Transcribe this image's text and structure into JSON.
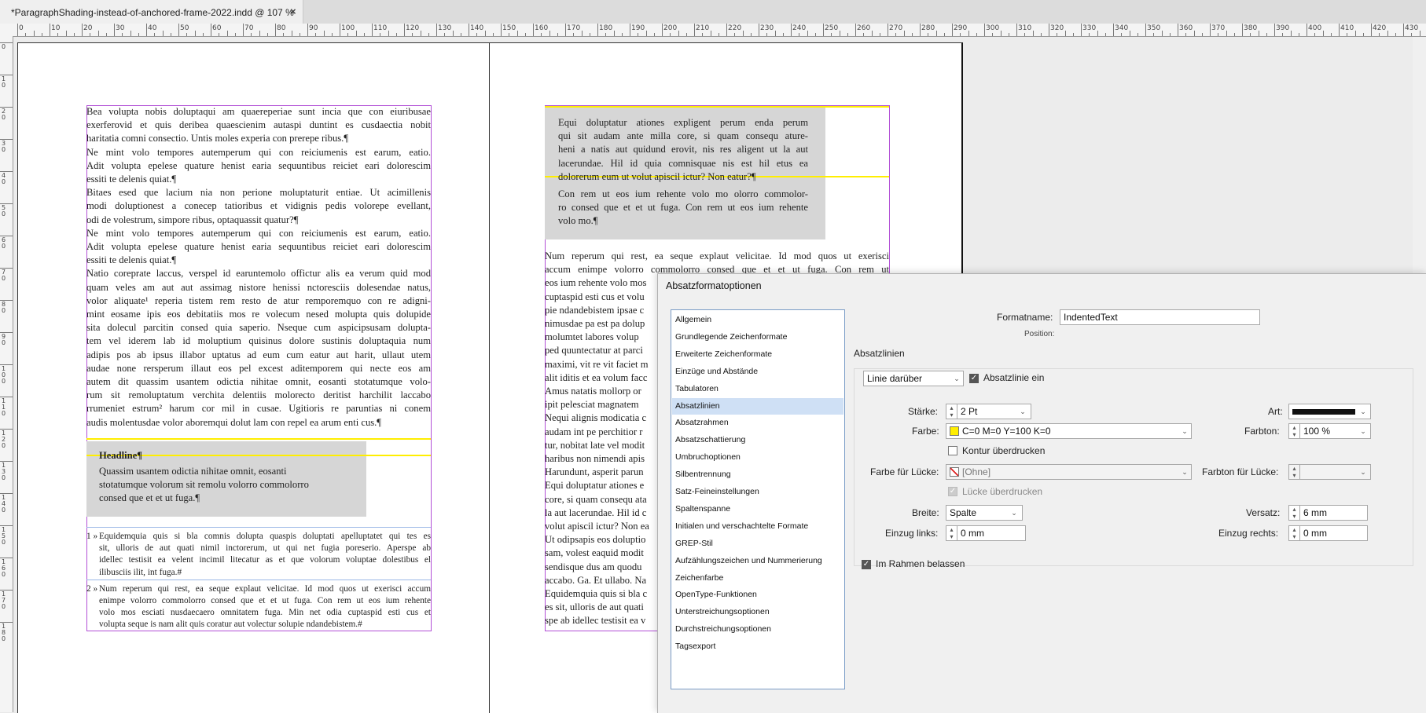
{
  "document_tab": {
    "title": "*ParagraphShading-instead-of-anchored-frame-2022.indd @ 107 %",
    "close": "×"
  },
  "ruler": {
    "h_labels": [
      "0",
      "10",
      "20",
      "30",
      "40",
      "50",
      "60",
      "70",
      "80",
      "90",
      "100",
      "110",
      "120",
      "130",
      "140",
      "150",
      "160",
      "170",
      "180",
      "190",
      "200",
      "210",
      "220",
      "230",
      "240",
      "250",
      "260",
      "270",
      "280",
      "290",
      "300",
      "310",
      "320",
      "330",
      "340",
      "350",
      "360",
      "370",
      "380",
      "390",
      "400",
      "410",
      "420",
      "430"
    ],
    "v_labels": [
      "0",
      "1 0",
      "2 0",
      "3 0",
      "4 0",
      "5 0",
      "6 0",
      "7 0",
      "8 0",
      "9 0",
      "1 0 0",
      "1 1 0",
      "1 2 0",
      "1 3 0",
      "1 4 0",
      "1 5 0",
      "1 6 0",
      "1 7 0",
      "1 8 0"
    ]
  },
  "colors": {
    "frame": "#b24fd6",
    "rule_yellow": "#ffee00",
    "shading": "#d6d6d6",
    "pilcrow": "#4a7fd4",
    "selection": "#cfe0f5"
  },
  "left_page": {
    "body_lines": [
      "Bea volupta nobis doluptaqui am quaereperiae sunt incia que con eiuribusae",
      "exerferovid et quis deribea quaescienim autaspi duntint es cusdaectia nobit",
      "haritatia comni consectio. Untis moles experia con prerepe ribus.¶",
      "Ne mint volo tempores autemperum qui con reiciumenis est earum, eatio.",
      "Adit volupta epelese quature henist earia sequuntibus reiciet eari dolorescim",
      "essiti te delenis quiat.¶",
      "Bitaes esed que lacium nia non perione moluptaturit entiae. Ut acimillenis",
      "modi doluptionest a conecep tatioribus et vidignis pedis volorepe evellant,",
      "odi de volestrum, simpore ribus, optaquassit quatur?¶",
      "Ne mint volo tempores autemperum qui con reiciumenis est earum, eatio.",
      "Adit volupta epelese quature henist earia sequuntibus reiciet eari dolorescim",
      "essiti te delenis quiat.¶",
      "Natio corepratе laccus, verspel id earuntemolo offictur alis ea verum quid mod",
      "quam veles am aut aut assimag nistore henissi nctoresciis dolesendae natus,",
      "volor aliquate¹ reperia tistem rem resto de atur remporemquo con re adigni-",
      "mint eosame ipis eos debitatiis mos re volecum nesed molupta quis dolupide",
      "sita dolecul parcitin consed quia saperio. Nseque cum aspicipsusam dolupta-",
      "tem vel iderem lab id moluptium quisinus dolore sustinis doluptaquia num",
      "adipis pos ab ipsus illabor uptatus ad eum cum eatur aut harit, ullaut utem",
      "audae none rersperum illaut eos pel excest aditemporem qui necte eos am",
      "autem dit quassim usantem odictia nihitae omnit, eosanti stotatumque volo-",
      "rum sit remoluptatum verchita delentiis molorecto deritist harchilit laccabo",
      "rrumeniet estrum² harum cor mil in cusae. Ugitioris re paruntias ni conem",
      "audis molentusdae volor aboremqui dolut lam con repel ea arum enti cus.¶"
    ],
    "headline": "Headline¶",
    "shaded_lines": [
      "Quassim usantem odictia nihitae omnit, eosanti",
      "stotatumque volorum sit remolu volorro commolorro",
      "consed que et et ut fuga.¶"
    ],
    "footnotes": [
      {
        "num": "1 »",
        "lines": [
          "Equidemquia quis si bla comnis dolupta quaspis doluptati apelluptatet qui tes es",
          "sit, ulloris de aut quati nimil inctorerum, ut qui net fugia poreserio. Aperspe ab",
          "idellec testisit ea velent incimil litecatur as et que volorum voluptae dolestibus el",
          "ilibusciis ilit, int fuga.#"
        ]
      },
      {
        "num": "2 »",
        "lines": [
          "Num reperum qui rest, ea seque explaut velicitae. Id mod quos ut exerisci accum",
          "enimpe volorro commolorro consed que et et ut fuga. Con rem ut eos ium rehente",
          "volo mos esciati nusdaecaero omnitatem fuga. Min net odia cuptaspid esti cus et",
          "volupta seque is nam alit quis coratur aut volectur solupie ndandebistem.#"
        ]
      }
    ]
  },
  "right_page": {
    "shaded_p1": [
      "Equi doluptatur ationes expligent perum enda perum",
      "qui sit audam ante milla core, si quam consequ ature-",
      "heni a natis aut quidund erovit, nis res aligent ut la aut",
      "lacerundae. Hil id quia comnisquae nis est hil etus ea",
      "dolorerum eum ut volut apiscil ictur? Non eatur?¶"
    ],
    "shaded_p2": [
      "Con rem ut eos ium rehente volo mo olorro commolor-",
      "ro consed que et et ut fuga. Con rem ut eos ium rehente",
      "volo mo.¶"
    ],
    "body_full": [
      "Num reperum qui rest, ea seque explaut velicitae. Id mod quos ut exerisci",
      "accum enimpe volorro commolorro consed que et et ut fuga. Con rem ut"
    ],
    "body_clipped": [
      "eos ium rehente volo mos",
      "cuptaspid esti cus et volu",
      "pie ndandebistem ipsae c",
      "nimusdae pa est pa dolup",
      "molumtet labores volup",
      "ped quuntectatur at parci",
      "maximi, vit re vit faciet m",
      "alit iditis et ea volum facc",
      "Amus natatis mollorp or",
      "ipit pelesciat magnatem",
      "Nequi alignis modicatia c",
      "audam int pe perchitior r",
      "tur, nobitat late vel modit",
      "haribus non nimendi apis",
      "Harundunt, asperit parun",
      "Equi doluptatur ationes e",
      "core, si quam consequ ata",
      "la aut lacerundae. Hil id c",
      "volut apiscil ictur? Non ea",
      "Ut odipsapis eos doluptio",
      "sam, volest eaquid modit",
      "sendisque dus am quodu",
      "accabo. Ga. Et ullabo. Na",
      "Equidemquia quis si bla c",
      "es sit, ulloris de aut quati",
      "spe ab idellec testisit ea v"
    ]
  },
  "dialog": {
    "title": "Absatzformatoptionen",
    "categories": [
      "Allgemein",
      "Grundlegende Zeichenformate",
      "Erweiterte Zeichenformate",
      "Einzüge und Abstände",
      "Tabulatoren",
      "Absatzlinien",
      "Absatzrahmen",
      "Absatzschattierung",
      "Umbruchoptionen",
      "Silbentrennung",
      "Satz-Feineinstellungen",
      "Spaltenspanne",
      "Initialen und verschachtelte Formate",
      "GREP-Stil",
      "Aufzählungszeichen und Nummerierung",
      "Zeichenfarbe",
      "OpenType-Funktionen",
      "Unterstreichungsoptionen",
      "Durchstreichungsoptionen",
      "Tagsexport"
    ],
    "selected_category": "Absatzlinien",
    "format_name_label": "Formatname:",
    "format_name_value": "IndentedText",
    "position_label": "Position:",
    "section_title": "Absatzlinien",
    "rule_position": "Linie darüber",
    "rule_on_label": "Absatzlinie ein",
    "weight_label": "Stärke:",
    "weight_value": "2 Pt",
    "type_label": "Art:",
    "color_label": "Farbe:",
    "color_value": "C=0 M=0 Y=100 K=0",
    "color_swatch": "#ffee00",
    "tint_label": "Farbton:",
    "tint_value": "100 %",
    "overprint_label": "Kontur überdrucken",
    "gap_color_label": "Farbe für Lücke:",
    "gap_color_value": "[Ohne]",
    "gap_tint_label": "Farbton für Lücke:",
    "gap_overprint_label": "Lücke überdrucken",
    "width_label": "Breite:",
    "width_value": "Spalte",
    "offset_label": "Versatz:",
    "offset_value": "6 mm",
    "left_indent_label": "Einzug links:",
    "left_indent_value": "0 mm",
    "right_indent_label": "Einzug rechts:",
    "right_indent_value": "0 mm",
    "keep_in_frame_label": "Im Rahmen belassen"
  }
}
